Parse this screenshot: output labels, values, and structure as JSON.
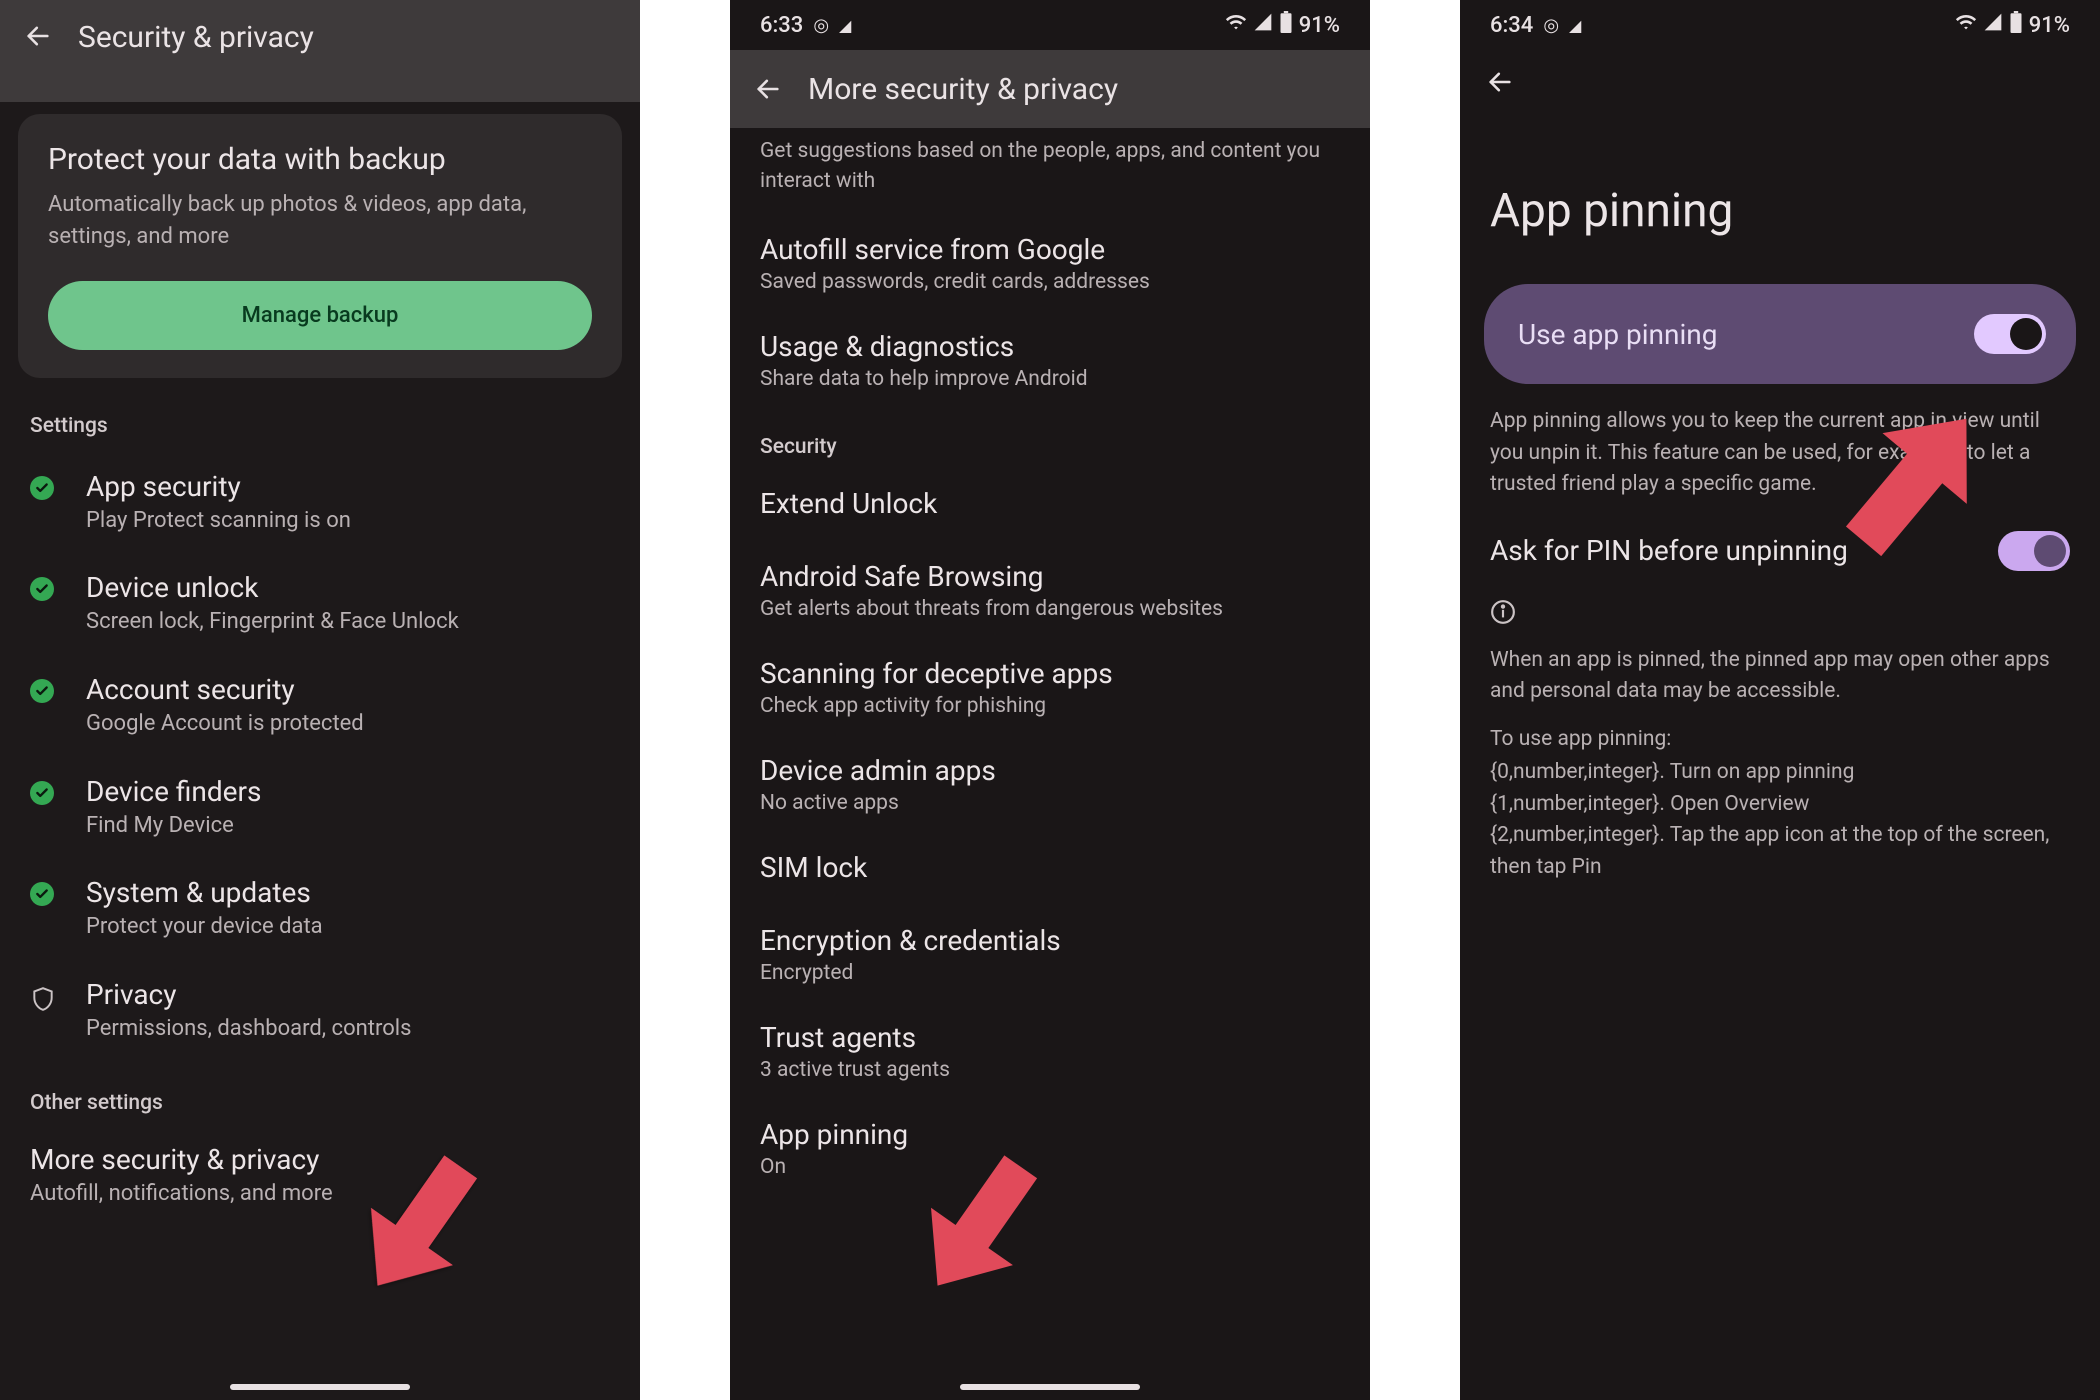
{
  "screen1": {
    "appbar_title": "Security & privacy",
    "backup_card": {
      "title": "Protect your data with backup",
      "subtitle": "Automatically back up photos & videos, app data, settings, and more",
      "button": "Manage backup"
    },
    "settings_label": "Settings",
    "items": [
      {
        "title": "App security",
        "sub": "Play Protect scanning is on",
        "icon": "check"
      },
      {
        "title": "Device unlock",
        "sub": "Screen lock, Fingerprint & Face Unlock",
        "icon": "check"
      },
      {
        "title": "Account security",
        "sub": "Google Account is protected",
        "icon": "check"
      },
      {
        "title": "Device finders",
        "sub": "Find My Device",
        "icon": "check"
      },
      {
        "title": "System & updates",
        "sub": "Protect your device data",
        "icon": "check"
      },
      {
        "title": "Privacy",
        "sub": "Permissions, dashboard, controls",
        "icon": "shield"
      }
    ],
    "other_label": "Other settings",
    "more": {
      "title": "More security & privacy",
      "sub": "Autofill, notifications, and more"
    }
  },
  "screen2": {
    "status_time": "6:33",
    "status_battery": "91%",
    "appbar_title": "More security & privacy",
    "header_sub": "Get suggestions based on the people, apps, and content you interact with",
    "items_top": [
      {
        "title": "Autofill service from Google",
        "sub": "Saved passwords, credit cards, addresses"
      },
      {
        "title": "Usage & diagnostics",
        "sub": "Share data to help improve Android"
      }
    ],
    "security_label": "Security",
    "items_sec": [
      {
        "title": "Extend Unlock",
        "sub": ""
      },
      {
        "title": "Android Safe Browsing",
        "sub": "Get alerts about threats from dangerous websites"
      },
      {
        "title": "Scanning for deceptive apps",
        "sub": "Check app activity for phishing"
      },
      {
        "title": "Device admin apps",
        "sub": "No active apps"
      },
      {
        "title": "SIM lock",
        "sub": ""
      },
      {
        "title": "Encryption & credentials",
        "sub": "Encrypted"
      },
      {
        "title": "Trust agents",
        "sub": "3 active trust agents"
      },
      {
        "title": "App pinning",
        "sub": "On"
      }
    ]
  },
  "screen3": {
    "status_time": "6:34",
    "status_battery": "91%",
    "page_title": "App pinning",
    "toggle_main": {
      "label": "Use app pinning",
      "on": true
    },
    "desc1": "App pinning allows you to keep the current app in view until you unpin it. This feature can be used, for example, to let a trusted friend play a specific game.",
    "toggle_pin": {
      "label": "Ask for PIN before unpinning",
      "on": true
    },
    "desc2": "When an app is pinned, the pinned app may open other apps and personal data may be accessible.",
    "howto_intro": "To use app pinning:",
    "howto_lines": [
      "{0,number,integer}. Turn on app pinning",
      "{1,number,integer}. Open Overview",
      "{2,number,integer}. Tap the app icon at the top of the screen, then tap Pin"
    ]
  },
  "annotation_color": "#e14a5a"
}
